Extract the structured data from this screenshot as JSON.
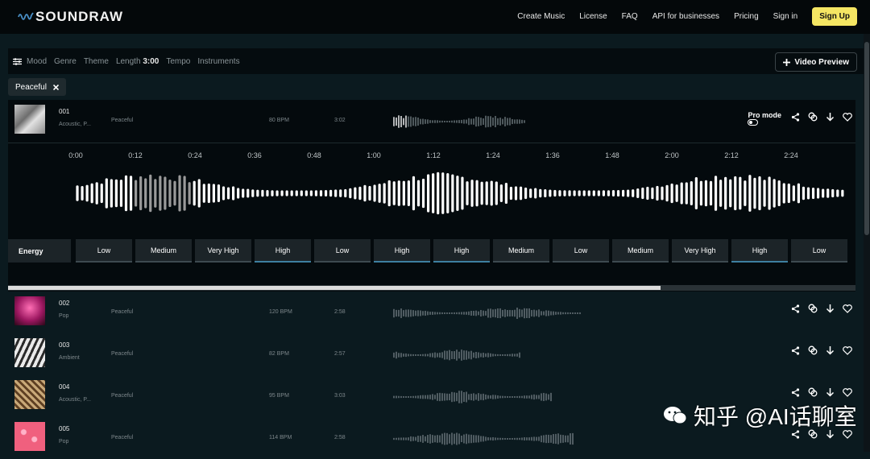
{
  "brand": {
    "name": "SOUNDRAW"
  },
  "nav": {
    "create_music": "Create Music",
    "license": "License",
    "faq": "FAQ",
    "api": "API for businesses",
    "pricing": "Pricing",
    "sign_in": "Sign in",
    "sign_up": "Sign Up"
  },
  "filters": {
    "mood": "Mood",
    "genre": "Genre",
    "theme": "Theme",
    "length_label": "Length",
    "length_value": "3:00",
    "tempo": "Tempo",
    "instruments": "Instruments",
    "video_preview": "Video Preview"
  },
  "active_tag": "Peaceful",
  "tracks": [
    {
      "num": "001",
      "genre": "Acoustic, P...",
      "mood": "Peaceful",
      "bpm": "80 BPM",
      "length": "3:02"
    },
    {
      "num": "002",
      "genre": "Pop",
      "mood": "Peaceful",
      "bpm": "120 BPM",
      "length": "2:58"
    },
    {
      "num": "003",
      "genre": "Ambient",
      "mood": "Peaceful",
      "bpm": "82 BPM",
      "length": "2:57"
    },
    {
      "num": "004",
      "genre": "Acoustic, P...",
      "mood": "Peaceful",
      "bpm": "95 BPM",
      "length": "3:03"
    },
    {
      "num": "005",
      "genre": "Pop",
      "mood": "Peaceful",
      "bpm": "114 BPM",
      "length": "2:58"
    }
  ],
  "pro_mode": "Pro mode",
  "timeline": [
    "0:00",
    "0:12",
    "0:24",
    "0:36",
    "0:48",
    "1:00",
    "1:12",
    "1:24",
    "1:36",
    "1:48",
    "2:00",
    "2:12",
    "2:24"
  ],
  "energy_label": "Energy",
  "energy": [
    "Low",
    "Medium",
    "Very High",
    "High",
    "Low",
    "High",
    "High",
    "Medium",
    "Low",
    "Medium",
    "Very High",
    "High",
    "Low"
  ],
  "scroll_progress": 0.77,
  "watermark": "知乎 @AI话聊室",
  "colors": {
    "accent": "#f5e663",
    "background": "#0b1a1f",
    "bar_underline": "#3d7fa0"
  }
}
